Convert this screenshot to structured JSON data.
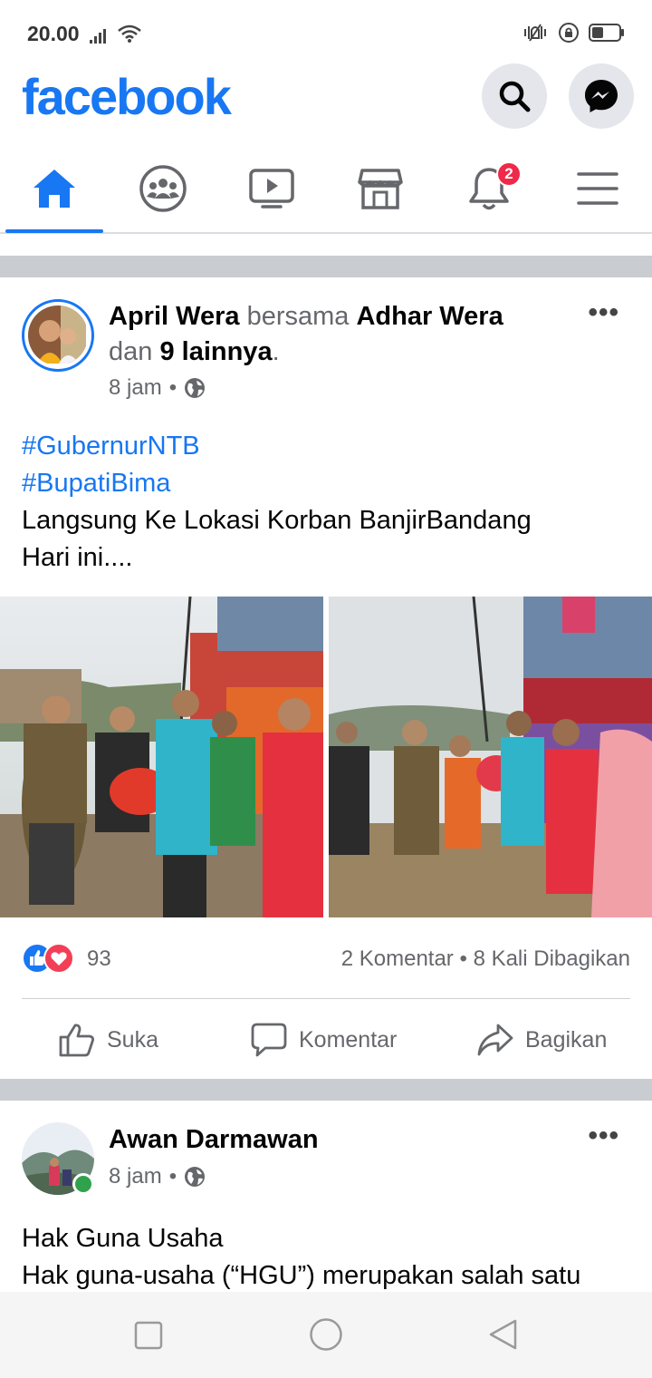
{
  "status_bar": {
    "time": "20.00",
    "icons": [
      "signal-icon",
      "wifi-icon",
      "vibrate-icon",
      "rotation-lock-icon",
      "battery-icon"
    ]
  },
  "header": {
    "logo": "facebook",
    "brand_color": "#1877f2",
    "buttons": [
      "search-icon",
      "messenger-icon"
    ]
  },
  "nav": {
    "tabs": [
      "home-icon",
      "groups-icon",
      "watch-icon",
      "marketplace-icon",
      "notifications-icon",
      "menu-icon"
    ],
    "active_index": 0,
    "notification_badge": "2"
  },
  "posts": [
    {
      "author": "April Wera",
      "with_word": "bersama",
      "tagged": "Adhar Wera",
      "and_word": "dan",
      "others": "9 lainnya",
      "period": ".",
      "time": "8 jam",
      "hashtags": [
        "#GubernurNTB",
        "#BupatiBima"
      ],
      "text_lines": [
        "Langsung Ke Lokasi Korban BanjirBandang",
        "Hari ini...."
      ],
      "reaction_count": "93",
      "comments": "2 Komentar",
      "shares": "8 Kali Dibagikan",
      "actions": [
        "Suka",
        "Komentar",
        "Bagikan"
      ]
    },
    {
      "author": "Awan Darmawan",
      "time": "8 jam",
      "text_lines": [
        "Hak Guna Usaha",
        "Hak guna-usaha (“HGU”) merupakan salah satu"
      ]
    }
  ],
  "android_nav": [
    "recent-apps-icon",
    "home-circle-icon",
    "back-icon"
  ]
}
